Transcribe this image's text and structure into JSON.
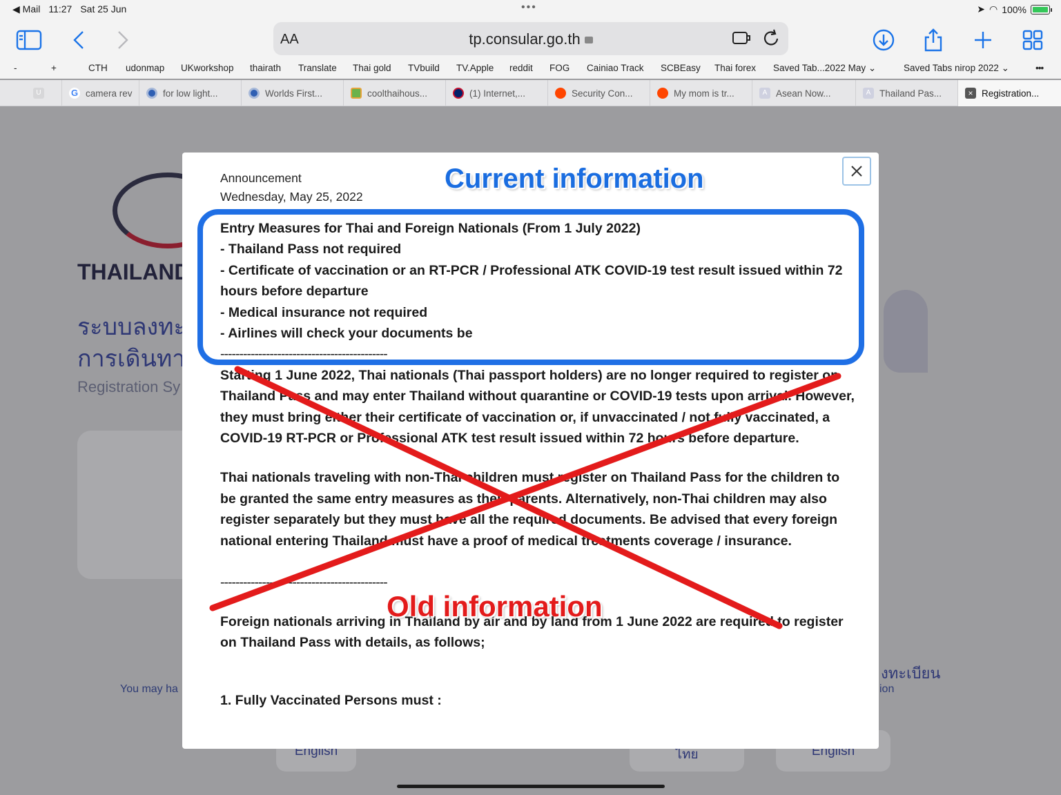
{
  "status": {
    "app_back": "◀ Mail",
    "time": "11:27",
    "date": "Sat 25 Jun",
    "battery": "100%"
  },
  "toolbar": {
    "aa": "AA",
    "url": "tp.consular.go.th"
  },
  "bookmarks": [
    "-",
    "+",
    "CTH",
    "udonmap",
    "UKworkshop",
    "thairath",
    "Translate",
    "Thai gold",
    "TVbuild",
    "TV.Apple",
    "reddit",
    "FOG",
    "Cainiao Track",
    "SCBEasy",
    "Thai forex",
    "Saved Tab...2022 May",
    "Saved Tabs nirop 2022",
    "•••"
  ],
  "tabs": [
    {
      "label": "",
      "fav": "#d7d7d9"
    },
    {
      "label": "camera rev",
      "fav": "#ffffff",
      "glyph": "G"
    },
    {
      "label": "for low light...",
      "fav": "#2f5fb3"
    },
    {
      "label": "Worlds First...",
      "fav": "#2f5fb3"
    },
    {
      "label": "coolthaihous...",
      "fav": "#6cb24a"
    },
    {
      "label": "(1) Internet,...",
      "fav": "#c8102e"
    },
    {
      "label": "Security Con...",
      "fav": "#ff4500"
    },
    {
      "label": "My mom is tr...",
      "fav": "#ff4500"
    },
    {
      "label": "Asean Now...",
      "fav": "#cfd1e0",
      "glyph": "A"
    },
    {
      "label": "Thailand Pas...",
      "fav": "#cfd1e0",
      "glyph": "A"
    },
    {
      "label": "Registration...",
      "fav": "#555555",
      "glyph": "×",
      "active": true
    }
  ],
  "bg": {
    "brand": "THAILAND",
    "thai1": "ระบบลงทะ",
    "thai2": "การเดินทา",
    "reg": "Registration Sy",
    "note": "You may ha",
    "reg_right": "งทะเบียน",
    "ion": "ion",
    "btn1": "English",
    "btn2": "ไทย",
    "btn3": "English"
  },
  "modal": {
    "announcement": "Announcement",
    "date": "Wednesday, May 25, 2022",
    "current_label": "Current information",
    "old_label": "Old information",
    "current_lines": [
      "Entry Measures for Thai and Foreign Nationals (From 1 July 2022)",
      "- Thailand Pass not required",
      "- Certificate of vaccination or an RT-PCR / Professional ATK COVID-19 test result issued within 72 hours before departure",
      "- Medical insurance not required",
      "- Airlines will check your documents be"
    ],
    "separator": "--------------------------------------------",
    "para1": "Starting 1 June 2022, Thai nationals (Thai passport holders) are no longer required to register on Thailand Pass and may enter Thailand without quarantine or COVID-19 tests upon arrival. However, they must bring either their certificate of vaccination or, if unvaccinated / not fully vaccinated, a COVID-19 RT-PCR or Professional ATK test result issued within 72 hours before departure.",
    "para2": "Thai nationals traveling with non-Thai children must register on Thailand Pass for the children to be granted the same entry measures as their parents. Alternatively, non-Thai children may also register separately but they must have all the required documents. Be advised that every foreign national entering Thailand must have a proof of medical treatments coverage / insurance.",
    "separator2": "--------------------------------------------",
    "para3": "Foreign nationals arriving in Thailand by air and by land from 1 June 2022 are required to register on Thailand Pass with details, as follows;",
    "para4": "1. Fully Vaccinated Persons must :"
  },
  "colors": {
    "accent": "#1a73e8",
    "highlight_box": "#1f6fe5",
    "cross": "#e31b1b"
  }
}
